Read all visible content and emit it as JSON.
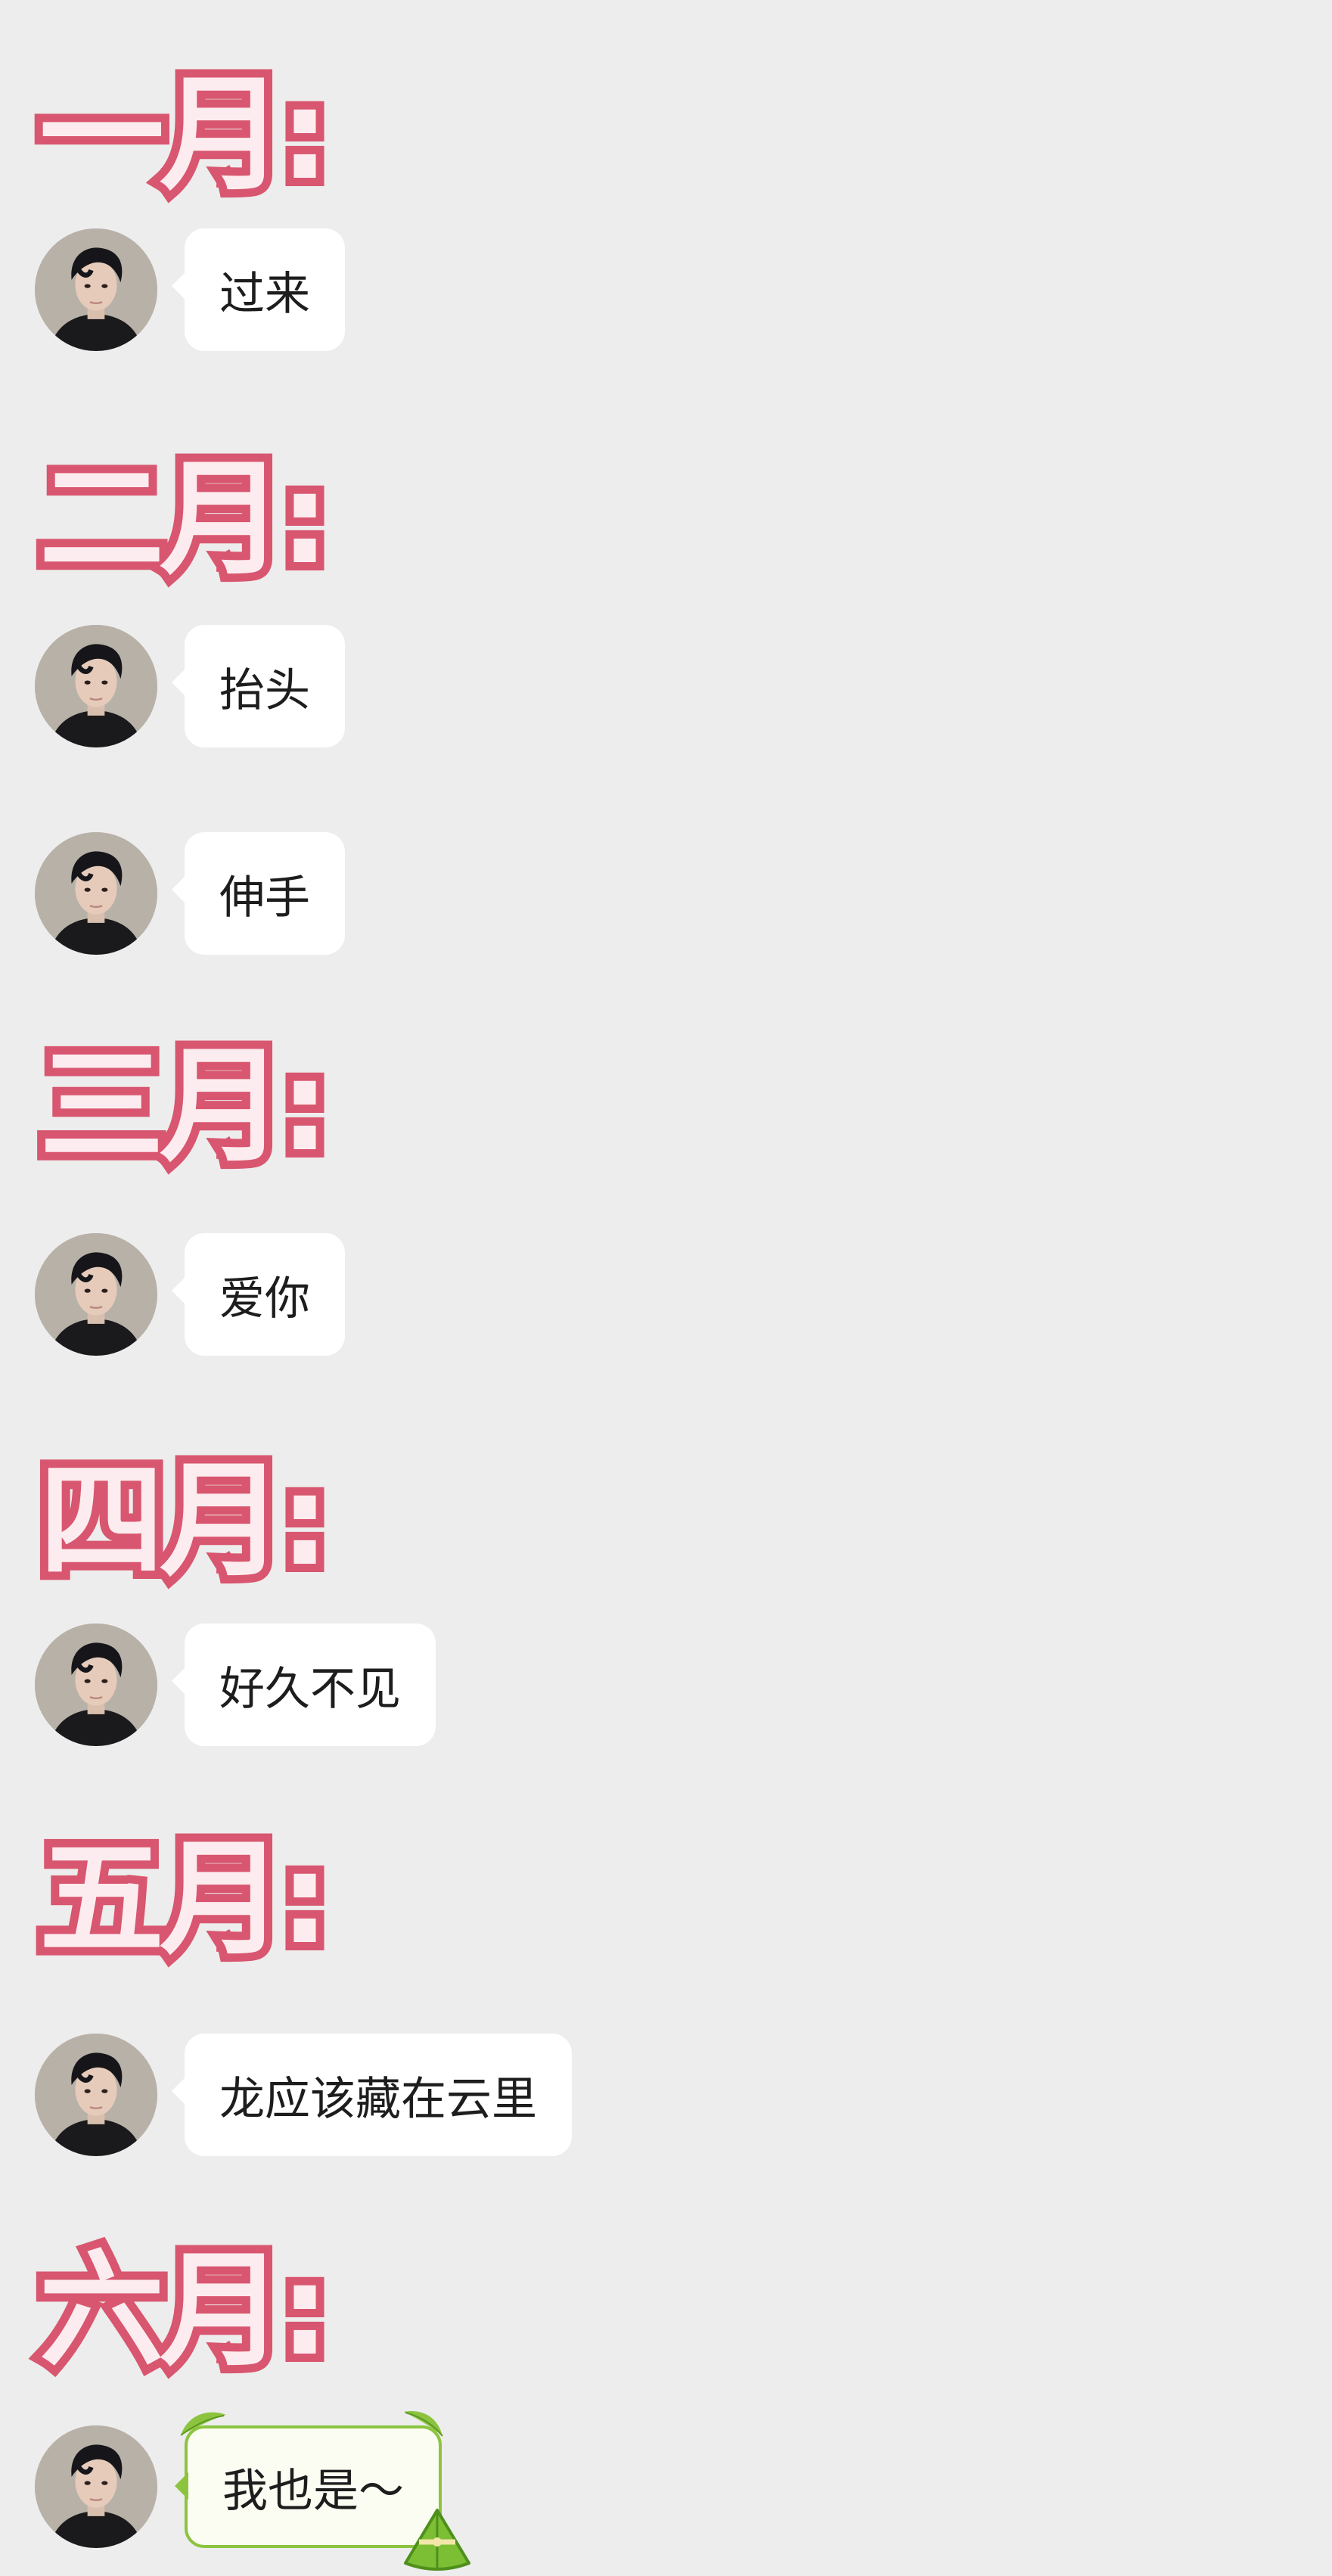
{
  "avatar": {
    "icon": "person-avatar-icon"
  },
  "months": [
    {
      "title": "一月:",
      "messages": [
        {
          "text": "过来"
        }
      ]
    },
    {
      "title": "二月:",
      "messages": [
        {
          "text": "抬头"
        },
        {
          "text": "伸手"
        }
      ]
    },
    {
      "title": "三月:",
      "messages": [
        {
          "text": "爱你"
        }
      ]
    },
    {
      "title": "四月:",
      "messages": [
        {
          "text": "好久不见"
        }
      ]
    },
    {
      "title": "五月:",
      "messages": [
        {
          "text": "龙应该藏在云里"
        }
      ]
    },
    {
      "title": "六月:",
      "messages": [
        {
          "text": "我也是～",
          "decoration": "zongzi-icon"
        }
      ]
    }
  ],
  "colors": {
    "background": "#ededed",
    "title_fill": "#fdecef",
    "title_outline": "#d8566f",
    "bubble": "#ffffff",
    "bubble_text": "#1d1d1d",
    "festive_border": "#8cc43f"
  }
}
